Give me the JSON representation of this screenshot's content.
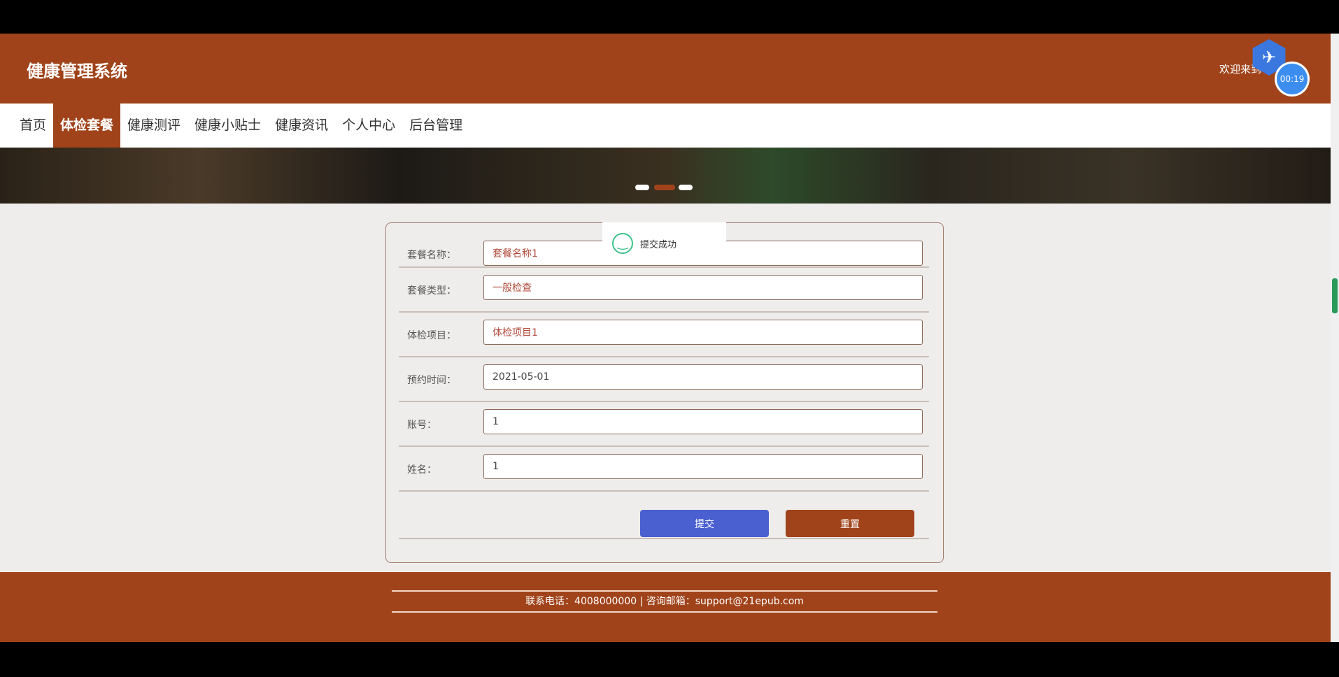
{
  "header": {
    "title": "健康管理系统",
    "welcome": "欢迎来到",
    "timer": "00:19"
  },
  "nav": [
    "首页",
    "体检套餐",
    "健康测评",
    "健康小贴士",
    "健康资讯",
    "个人中心",
    "后台管理"
  ],
  "toast": {
    "message": "提交成功"
  },
  "form": {
    "fields": [
      {
        "label": "套餐名称：",
        "value": "套餐名称1"
      },
      {
        "label": "套餐类型：",
        "value": "一般检查"
      },
      {
        "label": "体检项目：",
        "value": "体检项目1"
      },
      {
        "label": "预约时间：",
        "value": "2021-05-01"
      },
      {
        "label": "账号：",
        "value": "1"
      },
      {
        "label": "姓名：",
        "value": "1"
      }
    ],
    "submit": "提交",
    "reset": "重置"
  },
  "footer": {
    "text": "联系电话：4008000000 | 咨询邮箱：support@21epub.com"
  },
  "colors": {
    "brand": "#a0431a",
    "submit": "#4a5fd0"
  }
}
